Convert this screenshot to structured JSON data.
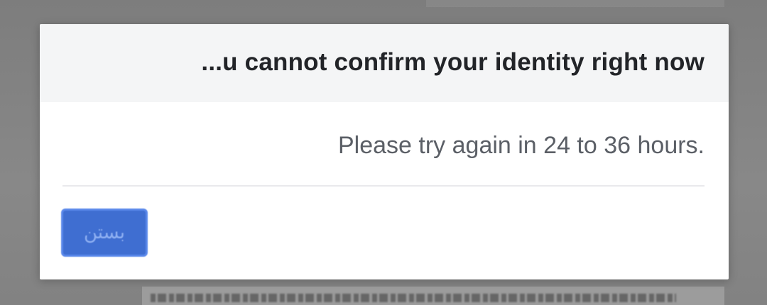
{
  "dialog": {
    "title": "...u cannot confirm your identity right now",
    "message": "Please try again in 24 to 36 hours.",
    "close_label": "بستن"
  },
  "colors": {
    "overlay": "#888888",
    "header_bg": "#f4f5f6",
    "title_text": "#222428",
    "message_text": "#5b5f66",
    "button_bg": "#3f6ed1"
  }
}
